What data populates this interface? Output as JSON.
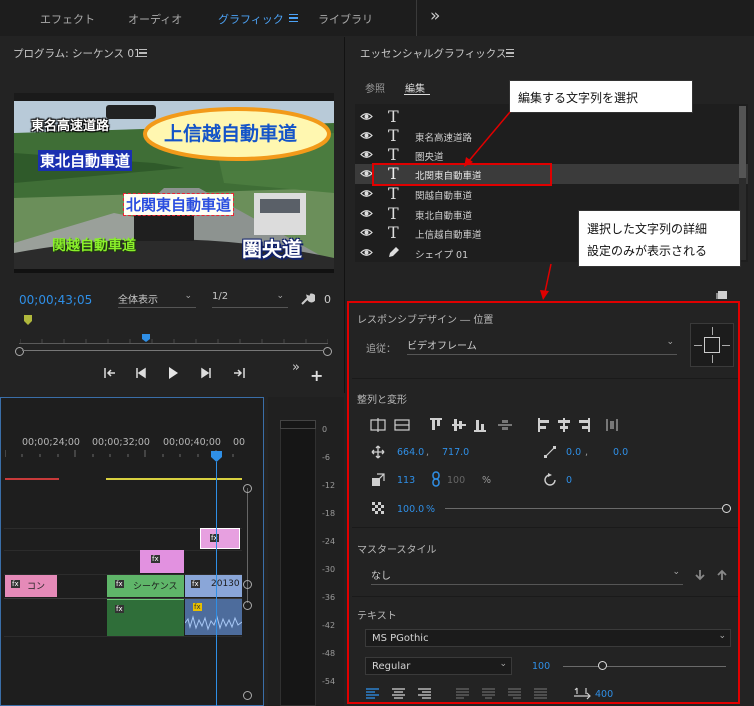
{
  "workspace_tabs": [
    {
      "label": "エフェクト",
      "active": false
    },
    {
      "label": "オーディオ",
      "active": false
    },
    {
      "label": "グラフィック",
      "active": true
    },
    {
      "label": "ライブラリ",
      "active": false
    }
  ],
  "overflow_label": "»",
  "program": {
    "title": "プログラム: シーケンス 01",
    "timecode": "00;00;43;05",
    "zoom": "全体表示",
    "resolution": "1/2",
    "wrench_suffix": "0",
    "video_labels": {
      "tomei": "東名高速道路",
      "joshinetsu": "上信越自動車道",
      "tohoku": "東北自動車道",
      "kitakanto": "北関東自動車道",
      "kanetsu": "関越自動車道",
      "kenodo": "圏央道"
    }
  },
  "timeline": {
    "ruler": [
      "00;00;24;00",
      "00;00;32;00",
      "00;00;40;00",
      "00"
    ],
    "clips": {
      "con": "コン",
      "sequence": "シーケンス",
      "num": "20130",
      "fx": "fx"
    }
  },
  "meter": {
    "scale": [
      "0",
      "-6",
      "-12",
      "-18",
      "-24",
      "-30",
      "-36",
      "-42",
      "-48",
      "-54"
    ]
  },
  "essential_graphics": {
    "title": "エッセンシャルグラフィックス",
    "tabs": [
      {
        "label": "参照"
      },
      {
        "label": "編集"
      }
    ],
    "layers": [
      {
        "name": ""
      },
      {
        "name": "東名高速道路"
      },
      {
        "name": "圏央道"
      },
      {
        "name": "北関東自動車道"
      },
      {
        "name": "関越自動車道"
      },
      {
        "name": "東北自動車道"
      },
      {
        "name": "上信越自動車道"
      },
      {
        "name": "シェイプ 01"
      }
    ],
    "responsive": {
      "section_title": "レスポンシブデザイン ― 位置",
      "follow_label": "追従：",
      "follow_value": "ビデオフレーム"
    },
    "align": {
      "section_title": "整列と変形",
      "pos_x": "664.0",
      "pos_y": "717.0",
      "anchor_x": "0.0",
      "anchor_y": "0.0",
      "scale": "113",
      "scale_h": "100",
      "percent": "%",
      "rotation": "0",
      "opacity": "100.0",
      "opacity_unit": "%"
    },
    "master": {
      "section_title": "マスタースタイル",
      "value": "なし"
    },
    "text": {
      "section_title": "テキスト",
      "font": "MS PGothic",
      "style": "Regular",
      "size": "100",
      "tracking": "400"
    }
  },
  "callouts": {
    "c1": "編集する文字列を選択",
    "c2_line1": "選択した文字列の詳細",
    "c2_line2": "設定のみが表示される"
  },
  "colors": {
    "accent_blue": "#2f8fe6",
    "callout_red": "#e00000"
  }
}
